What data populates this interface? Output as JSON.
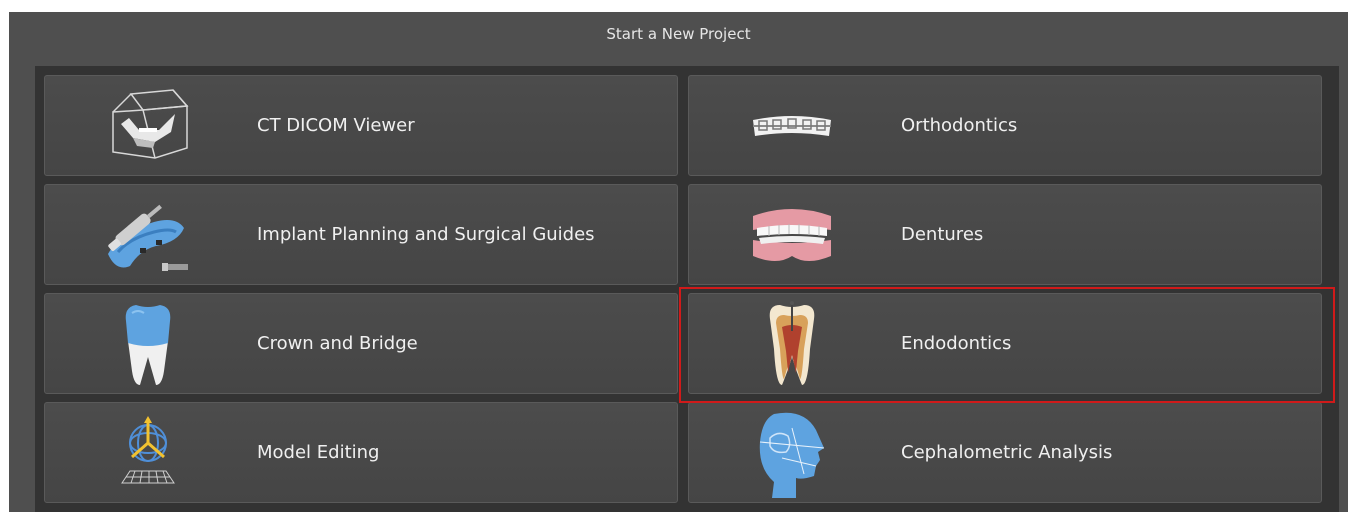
{
  "dialog": {
    "title": "Start a New Project"
  },
  "tiles": [
    {
      "label": "CT DICOM Viewer",
      "icon": "ct-dicom-viewer-icon"
    },
    {
      "label": "Orthodontics",
      "icon": "orthodontics-braces-icon"
    },
    {
      "label": "Implant Planning and Surgical Guides",
      "icon": "implant-planning-icon"
    },
    {
      "label": "Dentures",
      "icon": "dentures-icon"
    },
    {
      "label": "Crown and Bridge",
      "icon": "crown-tooth-icon"
    },
    {
      "label": "Endodontics",
      "icon": "endodontics-tooth-icon"
    },
    {
      "label": "Model Editing",
      "icon": "model-editing-icon"
    },
    {
      "label": "Cephalometric Analysis",
      "icon": "cephalometric-head-icon"
    }
  ],
  "selected_tile": "Endodontics",
  "colors": {
    "background": "#4f4f4f",
    "tile": "#4a4a4a",
    "highlight": "#d01a1a",
    "text": "#f0f0f0"
  }
}
